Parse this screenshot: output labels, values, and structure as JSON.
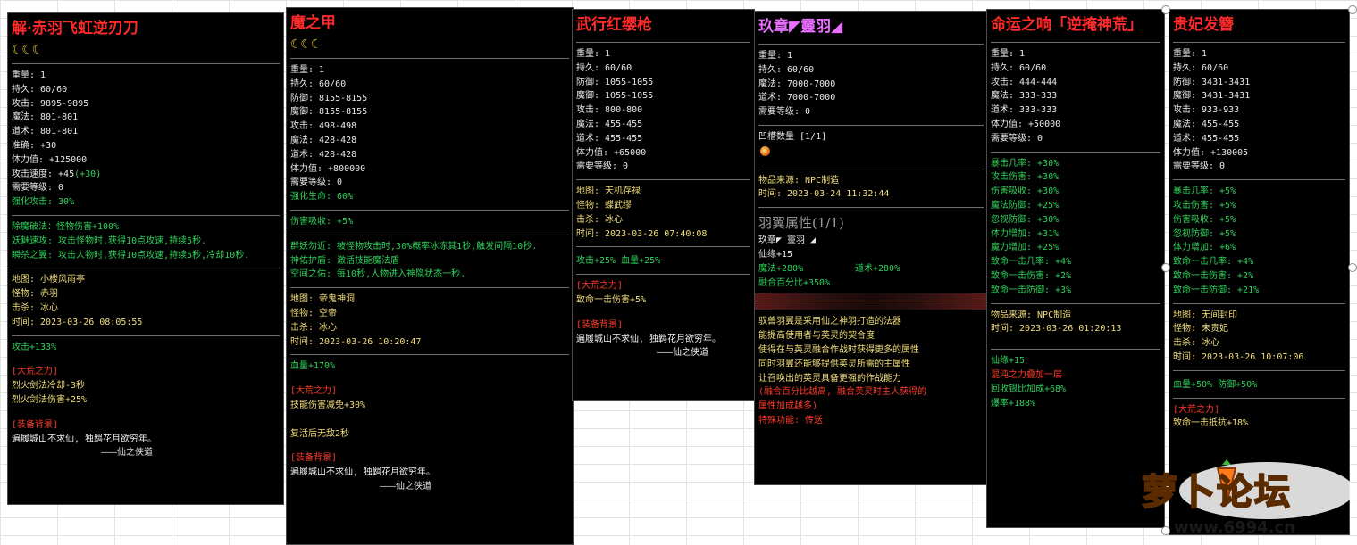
{
  "tooltips": [
    {
      "title": "解·赤羽飞虹逆刃刀",
      "moons": "☾☾☾",
      "stats": [
        "重量: 1",
        "持久: 60/60",
        "攻击: 9895-9895",
        "魔法: 801-801",
        "道术: 801-801",
        "准确: +30",
        "体力值: +125000"
      ],
      "speed_label": "攻击速度: +45",
      "speed_extra": "(+30)",
      "stats2": [
        "需要等级: 0"
      ],
      "strengthen": "强化攻击:    30%",
      "skills": [
        "除魔破法：怪物伤害+100%",
        "妖魅速攻: 攻击怪物时,获得10点攻速,持续5秒.",
        "瞬杀之翼: 攻击人物时,获得10点攻速,持续5秒,冷却10秒."
      ],
      "origin": [
        "地图: 小楼风雨亭",
        "怪物: 赤羽",
        "击杀: 冰心",
        "时间: 2023-03-26 08:05:55"
      ],
      "bonus": "攻击+133%",
      "power_title": "[大荒之力]",
      "power": [
        "烈火剑法冷却-3秒",
        "烈火剑法伤害+25%"
      ],
      "bg_title": "[装备背景]",
      "bg_text": "遍履城山不求仙, 独羁花月欲穷年。",
      "bg_sign": "———仙之侠道"
    },
    {
      "title": "魔之甲",
      "moons": "☾☾☾",
      "stats": [
        "重量: 1",
        "持久: 60/60",
        "防御: 8155-8155",
        "魔御: 8155-8155",
        "攻击: 498-498",
        "魔法: 428-428",
        "道术: 428-428",
        "体力值: +800000",
        "需要等级: 0"
      ],
      "strengthen": "强化生命:    60%",
      "absorb": "伤害吸收: +5%",
      "skills": [
        "群妖勿近: 被怪物攻击时,30%概率冰冻其1秒,触发间隔10秒.",
        "神佑护盾: 激活技能魔法盾",
        "空间之佑: 每10秒,人物进入神隐状态一秒."
      ],
      "origin": [
        "地图: 帝鬼神洞",
        "怪物: 空帝",
        "击杀: 冰心",
        "时间: 2023-03-26 10:20:47"
      ],
      "bonus": "血量+170%",
      "power_title": "[大荒之力]",
      "power": [
        "技能伤害减免+30%",
        "",
        "复活后无敌2秒"
      ],
      "bg_title": "[装备背景]",
      "bg_text": "遍履城山不求仙, 独羁花月欲穷年。",
      "bg_sign": "———仙之侠道"
    },
    {
      "title": "武行红缨枪",
      "stats": [
        "重量: 1",
        "持久: 60/60",
        "防御: 1055-1055",
        "魔御: 1055-1055",
        "攻击: 800-800",
        "魔法: 455-455",
        "道术: 455-455",
        "体力值: +65000",
        "需要等级: 0"
      ],
      "origin": [
        "地图: 天机存禄",
        "怪物: 蝶武缪",
        "击杀: 冰心",
        "时间: 2023-03-26 07:40:08"
      ],
      "bonus": "攻击+25%  血量+25%",
      "power_title": "[大荒之力]",
      "power": [
        "致命一击伤害+5%"
      ],
      "bg_title": "[装备背景]",
      "bg_text": "遍履城山不求仙, 独羁花月欲穷年。",
      "bg_sign": "———仙之侠道"
    },
    {
      "title": "玖章◤靈羽◢",
      "stats": [
        "重量: 1",
        "持久: 60/60",
        "魔法: 7000-7000",
        "道术: 7000-7000",
        "需要等级: 0"
      ],
      "slots": "凹槽数量 [1/1]",
      "source": [
        "物品来源: NPC制造",
        "时间: 2023-03-24 11:32:44"
      ],
      "wing_title": "羽翼属性(1/1)",
      "wing_name": "玖章◤ 靈羽 ◢",
      "wing_stats": [
        "仙缘+15"
      ],
      "wing_magic": "魔法+280%",
      "wing_tao": "道术+280%",
      "wing_fuse": "融合百分比+350%",
      "desc": [
        "驭兽羽翼是采用仙之神羽打造的法器",
        "能提高使用者与英灵的契合度",
        "使得在与英灵融合作战时获得更多的属性",
        "同时羽翼还能够提供英灵所需的主属性",
        "让召唤出的英灵具备更强的作战能力"
      ],
      "desc_red": [
        "(融合百分比越高, 融合英灵时主人获得的",
        "属性加成越多)"
      ],
      "special": "特殊功能: 传送"
    },
    {
      "title": "命运之响「逆掩神荒」",
      "stats": [
        "重量: 1",
        "持久: 60/60",
        "攻击: 444-444",
        "魔法: 333-333",
        "道术: 333-333",
        "体力值: +50000",
        "需要等级: 0"
      ],
      "bonuses": [
        "暴击几率: +30%",
        "攻击伤害: +30%",
        "伤害吸收: +30%",
        "魔法防御: +25%",
        "忽视防御: +30%",
        "体力增加: +31%",
        "魔力增加: +25%",
        "致命一击几率: +4%",
        "致命一击伤害: +2%",
        "致命一击防御: +3%"
      ],
      "source": [
        "物品来源: NPC制造",
        "时间: 2023-03-26 01:20:13"
      ],
      "extra": [
        "仙缘+15"
      ],
      "extra_red": "混沌之力叠加一层",
      "extra2": [
        "回收银比加成+68%",
        "爆率+188%"
      ]
    },
    {
      "title": "贵妃发簪",
      "stats": [
        "重量: 1",
        "持久: 60/60",
        "防御: 3431-3431",
        "魔御: 3431-3431",
        "攻击: 933-933",
        "魔法: 455-455",
        "道术: 455-455",
        "体力值: +130005",
        "需要等级: 0"
      ],
      "bonuses": [
        "暴击几率: +5%",
        "攻击伤害: +5%",
        "伤害吸收: +5%",
        "忽视防御: +5%",
        "体力增加: +6%",
        "致命一击几率: +4%",
        "致命一击伤害: +2%",
        "致命一击防御: +21%"
      ],
      "origin": [
        "地图: 无间封印",
        "怪物: 未贵妃",
        "击杀: 冰心",
        "时间: 2023-03-26 10:07:06"
      ],
      "bonus": "血量+50%  防御+50%",
      "power_title": "[大荒之力]",
      "power": [
        "致命一击抵抗+18%"
      ]
    }
  ],
  "watermark": {
    "brand": "萝卜论坛",
    "url": "www.6994.cn"
  },
  "colors": {
    "title_red": "#ff2a2a",
    "green": "#2fd05a",
    "yellow": "#f2dc7a",
    "red": "#ff3b2a",
    "pink": "#e96fff"
  }
}
